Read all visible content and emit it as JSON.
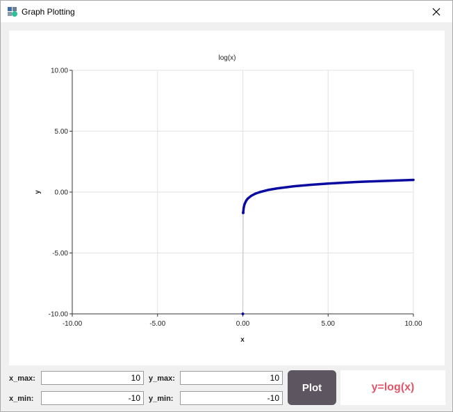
{
  "window": {
    "title": "Graph Plotting",
    "app_icon": "graph-app-icon",
    "close_icon": "close-icon"
  },
  "chart_data": {
    "type": "line",
    "title": "log(x)",
    "xlabel": "x",
    "ylabel": "y",
    "xlim": [
      -10,
      10
    ],
    "ylim": [
      -10,
      10
    ],
    "x_ticks": [
      "-10.00",
      "-5.00",
      "0.00",
      "5.00",
      "10.00"
    ],
    "y_ticks": [
      "10.00",
      "5.00",
      "0.00",
      "-5.00",
      "-10.00"
    ],
    "grid": true,
    "series": [
      {
        "color": "#0a0aa0",
        "x": [
          0.0,
          0.02,
          0.05,
          0.1,
          0.2,
          0.3,
          0.5,
          0.75,
          1,
          1.5,
          2,
          3,
          4,
          5,
          6,
          7,
          8,
          9,
          10
        ],
        "y": [
          -10.0,
          -1.7,
          -1.3,
          -1.0,
          -0.7,
          -0.52,
          -0.3,
          -0.12,
          0.0,
          0.18,
          0.3,
          0.48,
          0.6,
          0.7,
          0.78,
          0.85,
          0.9,
          0.95,
          1.0
        ]
      }
    ]
  },
  "controls": {
    "x_max_label": "x_max:",
    "x_max_value": "10",
    "x_min_label": "x_min:",
    "x_min_value": "-10",
    "y_max_label": "y_max:",
    "y_max_value": "10",
    "y_min_label": "y_min:",
    "y_min_value": "-10",
    "plot_label": "Plot",
    "formula": "y=log(x)",
    "formula_color": "#e0566a"
  }
}
